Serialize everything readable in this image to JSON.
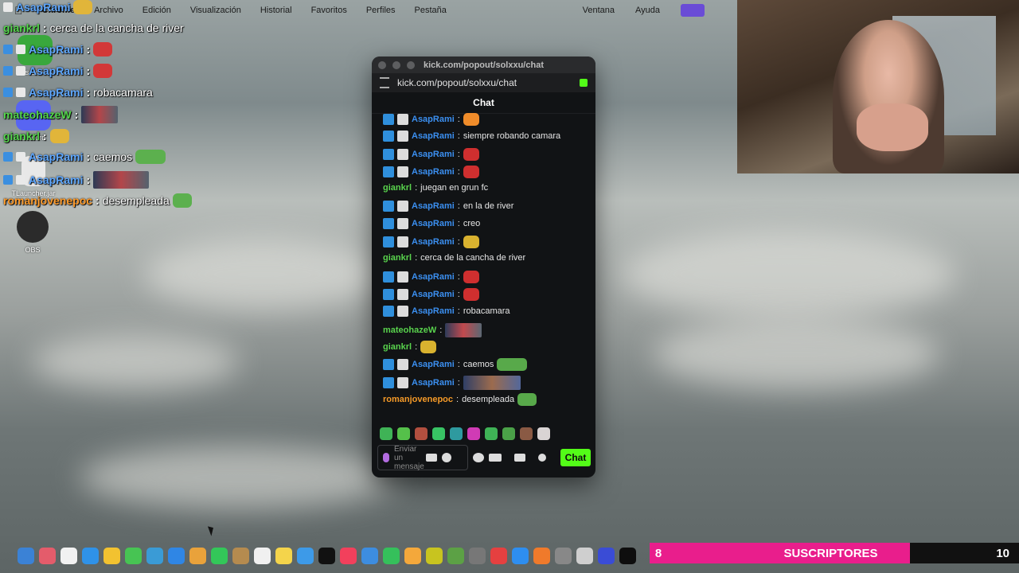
{
  "menubar": {
    "app": "Chrome",
    "items": [
      "Archivo",
      "Edición",
      "Visualización",
      "Historial",
      "Favoritos",
      "Perfiles",
      "Pestaña"
    ],
    "right_items": [
      "Ventana",
      "Ayuda"
    ]
  },
  "overlay": {
    "lines": [
      {
        "user": "AsapRami",
        "text": ""
      },
      {
        "user": "giankrl",
        "text": "cerca de la cancha de river"
      },
      {
        "user": "AsapRami",
        "text": ""
      },
      {
        "user": "AsapRami",
        "text": ""
      },
      {
        "user": "AsapRami",
        "text": "robacamara"
      },
      {
        "user": "mateohazeW",
        "text": ""
      },
      {
        "user": "giankrl",
        "text": ""
      },
      {
        "user": "AsapRami",
        "text": "caemos"
      },
      {
        "user": "AsapRami",
        "text": ""
      },
      {
        "user": "romanjovenepoc",
        "text": "desempleada"
      }
    ]
  },
  "desktop": {
    "icons": [
      {
        "label": "Los Sims 4"
      },
      {
        "label": "Discord"
      },
      {
        "label": "TLauncher.jar"
      },
      {
        "label": "OBS"
      }
    ]
  },
  "popout": {
    "window_title": "kick.com/popout/solxxu/chat",
    "url": "kick.com/popout/solxxu/chat",
    "header": "Chat",
    "messages": [
      {
        "user": "AsapRami",
        "text": ""
      },
      {
        "user": "AsapRami",
        "text": "siempre robando camara"
      },
      {
        "user": "AsapRami",
        "text": ""
      },
      {
        "user": "AsapRami",
        "text": ""
      },
      {
        "user": "giankrl",
        "text": "juegan en grun fc"
      },
      {
        "user": "AsapRami",
        "text": "en la de river"
      },
      {
        "user": "AsapRami",
        "text": "creo"
      },
      {
        "user": "AsapRami",
        "text": ""
      },
      {
        "user": "giankrl",
        "text": "cerca de la cancha de river"
      },
      {
        "user": "AsapRami",
        "text": ""
      },
      {
        "user": "AsapRami",
        "text": ""
      },
      {
        "user": "AsapRami",
        "text": "robacamara"
      },
      {
        "user": "mateohazeW",
        "text": ""
      },
      {
        "user": "giankrl",
        "text": ""
      },
      {
        "user": "AsapRami",
        "text": "caemos"
      },
      {
        "user": "AsapRami",
        "text": ""
      },
      {
        "user": "romanjovenepoc",
        "text": "desempleada"
      }
    ],
    "composer": {
      "placeholder": "Enviar un mensaje",
      "send_label": "Chat"
    }
  },
  "subs_goal": {
    "current": "8",
    "label": "SUSCRIPTORES",
    "goal": "10",
    "progress": 0.8
  },
  "colors": {
    "kick_green": "#53fc18",
    "subs_pink": "#e91e8c",
    "user_blue": "#3b8ff0"
  }
}
